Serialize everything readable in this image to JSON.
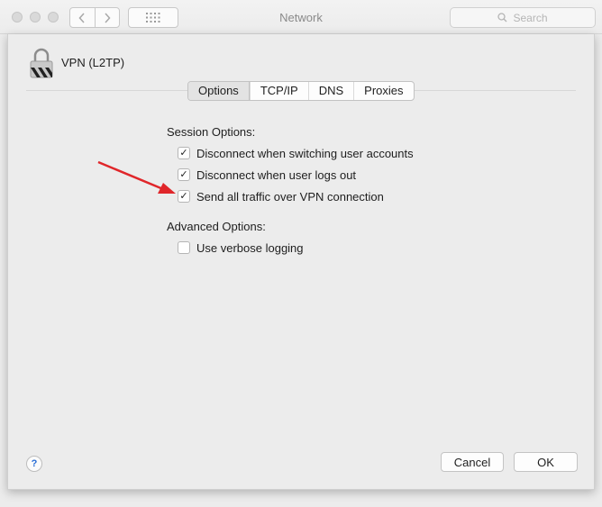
{
  "window": {
    "title": "Network"
  },
  "search": {
    "placeholder": "Search"
  },
  "connection": {
    "name": "VPN (L2TP)"
  },
  "tabs": [
    {
      "label": "Options",
      "active": true
    },
    {
      "label": "TCP/IP",
      "active": false
    },
    {
      "label": "DNS",
      "active": false
    },
    {
      "label": "Proxies",
      "active": false
    }
  ],
  "session": {
    "heading": "Session Options:",
    "items": [
      {
        "label": "Disconnect when switching user accounts",
        "checked": true
      },
      {
        "label": "Disconnect when user logs out",
        "checked": true
      },
      {
        "label": "Send all traffic over VPN connection",
        "checked": true
      }
    ]
  },
  "advanced": {
    "heading": "Advanced Options:",
    "items": [
      {
        "label": "Use verbose logging",
        "checked": false
      }
    ]
  },
  "checkmark": "✓",
  "help": {
    "label": "?"
  },
  "buttons": {
    "cancel": "Cancel",
    "ok": "OK"
  },
  "colors": {
    "annotation_arrow": "#e0262a",
    "help_accent": "#2a6ed6"
  }
}
